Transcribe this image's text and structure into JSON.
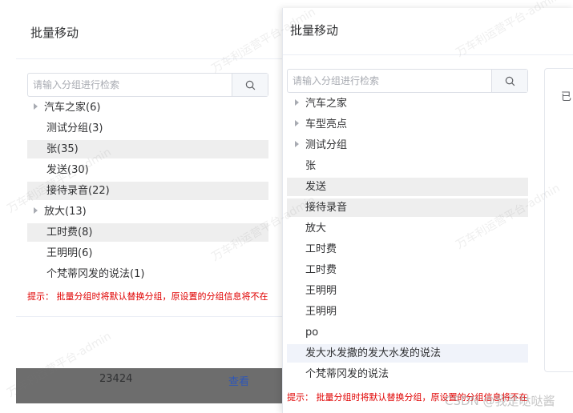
{
  "left_dialog": {
    "title": "批量移动",
    "search_placeholder": "请输入分组进行检索",
    "tree": [
      {
        "label": "汽车之家(6)",
        "expandable": true,
        "selected": false
      },
      {
        "label": "测试分组(3)",
        "expandable": false,
        "selected": false
      },
      {
        "label": "张(35)",
        "expandable": false,
        "selected": true
      },
      {
        "label": "发送(30)",
        "expandable": false,
        "selected": false
      },
      {
        "label": "接待录音(22)",
        "expandable": false,
        "selected": true
      },
      {
        "label": "放大(13)",
        "expandable": true,
        "selected": false
      },
      {
        "label": "工时费(8)",
        "expandable": false,
        "selected": true
      },
      {
        "label": "王明明(6)",
        "expandable": false,
        "selected": false
      },
      {
        "label": "个梵蒂冈发的说法(1)",
        "expandable": false,
        "selected": false
      }
    ],
    "hint": "提示： 批量分组时将默认替换分组，原设置的分组信息将不在"
  },
  "background_table": {
    "cell_value": "23424",
    "link_label": "查看"
  },
  "right_dialog": {
    "title": "批量移动",
    "search_placeholder": "请输入分组进行检索",
    "tree": [
      {
        "label": "汽车之家",
        "expandable": true,
        "state": "normal"
      },
      {
        "label": "车型亮点",
        "expandable": true,
        "state": "normal"
      },
      {
        "label": "测试分组",
        "expandable": true,
        "state": "normal"
      },
      {
        "label": "张",
        "expandable": false,
        "state": "normal"
      },
      {
        "label": "发送",
        "expandable": false,
        "state": "selected"
      },
      {
        "label": "接待录音",
        "expandable": false,
        "state": "selected"
      },
      {
        "label": "放大",
        "expandable": false,
        "state": "normal"
      },
      {
        "label": "工时费",
        "expandable": false,
        "state": "normal"
      },
      {
        "label": "工时费",
        "expandable": false,
        "state": "normal"
      },
      {
        "label": "王明明",
        "expandable": false,
        "state": "normal"
      },
      {
        "label": "王明明",
        "expandable": false,
        "state": "normal"
      },
      {
        "label": "po",
        "expandable": false,
        "state": "normal"
      },
      {
        "label": "发大水发撒的发大水发的说法",
        "expandable": false,
        "state": "hover"
      },
      {
        "label": "个梵蒂冈发的说法",
        "expandable": false,
        "state": "normal"
      }
    ],
    "hint": "提示： 批量分组时将默认替换分组，原设置的分组信息将不在",
    "side_panel_char": "已"
  },
  "watermark_text": "万车利运营平台-admin",
  "csdn_watermark": "CSDN @我是哒哒酱"
}
